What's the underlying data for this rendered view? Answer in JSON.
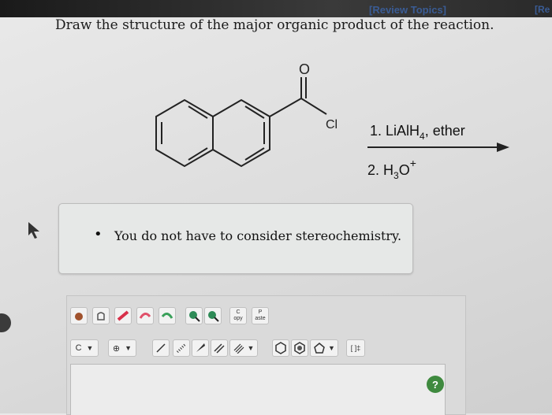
{
  "header": {
    "review_topics": "[Review Topics]",
    "review_topics_cut": "[Re"
  },
  "question": {
    "prompt": "Draw the structure of the major organic product of the reaction."
  },
  "reaction": {
    "carbonyl_o": "O",
    "chlorine": "Cl",
    "step1": "1. LiAlH",
    "step1_sub": "4",
    "step1_tail": ", ether",
    "step2": "2. H",
    "step2_sub": "3",
    "step2_o": "O",
    "step2_sup": "+"
  },
  "hint": {
    "bullet": "•",
    "text": "You do not have to consider stereochemistry."
  },
  "toolbar": {
    "copy_label": "C\nopy",
    "paste_label": "P\naste",
    "carbon_label": "C",
    "charge_label": "⊕",
    "bracket_label": "[ ]‡",
    "help_label": "?"
  }
}
